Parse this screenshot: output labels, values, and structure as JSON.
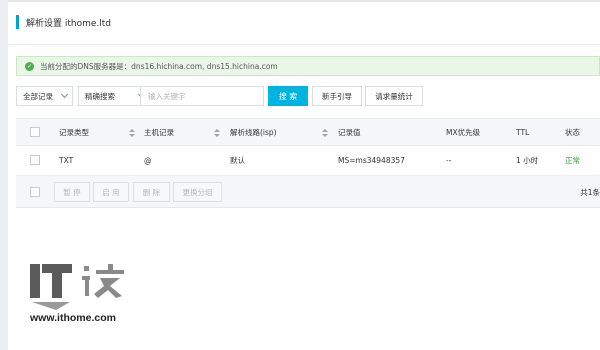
{
  "header": {
    "title": "解析设置 ithome.ltd"
  },
  "notice": {
    "text": "当前分配的DNS服务器是：dns16.hichina.com, dns15.hichina.com"
  },
  "toolbar": {
    "record_filter": "全部记录",
    "search_mode": "精确搜索",
    "search_placeholder": "输入关键字",
    "search_button": "搜 索",
    "guide_button": "新手引导",
    "stats_button": "请求量统计"
  },
  "table": {
    "columns": [
      "记录类型",
      "主机记录",
      "解析线路(isp)",
      "记录值",
      "MX优先级",
      "TTL",
      "状态"
    ],
    "rows": [
      {
        "type": "TXT",
        "host": "@",
        "line": "默认",
        "value": "MS=ms34948357",
        "mx": "--",
        "ttl": "1 小时",
        "status": "正常"
      }
    ],
    "footer_buttons": [
      "暂 停",
      "启 用",
      "删 除",
      "更换分组"
    ],
    "total": "共1条"
  },
  "watermark": {
    "url": "www.ithome.com",
    "logo_text": "IT之家"
  },
  "colors": {
    "accent": "#00b4e0",
    "status_ok": "#2fa336",
    "notice_bg": "#e9f6e8"
  }
}
